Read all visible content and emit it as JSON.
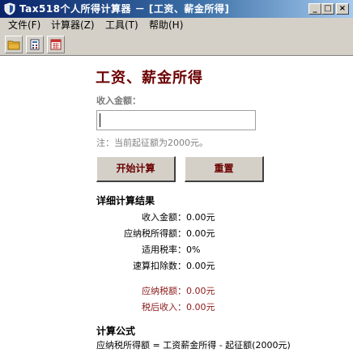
{
  "window": {
    "title": "Tax518个人所得计算器 － [工资、薪金所得]",
    "min_glyph": "_",
    "max_glyph": "□",
    "close_glyph": "×"
  },
  "menu": {
    "items": [
      {
        "label": "文件(F)"
      },
      {
        "label": "计算器(Z)"
      },
      {
        "label": "工具(T)"
      },
      {
        "label": "帮助(H)"
      }
    ]
  },
  "toolbar": {
    "icons": [
      "folder-icon",
      "calculator-doc-icon",
      "calendar-icon"
    ]
  },
  "form": {
    "heading": "工资、薪金所得",
    "income_label": "收入金额：",
    "income_value": "",
    "note": "注：当前起征额为2000元。",
    "start_button": "开始计算",
    "reset_button": "重置"
  },
  "results": {
    "title": "详细计算结果",
    "rows": [
      {
        "label": "收入金额：",
        "value": "0.00元"
      },
      {
        "label": "应纳税所得额：",
        "value": "0.00元"
      },
      {
        "label": "适用税率：",
        "value": "0%"
      },
      {
        "label": "速算扣除数：",
        "value": "0.00元"
      }
    ],
    "tax_rows": [
      {
        "label": "应纳税额：",
        "value": "0.00元"
      },
      {
        "label": "税后收入：",
        "value": "0.00元"
      }
    ]
  },
  "formula": {
    "title": "计算公式",
    "text": "应纳税所得额 = 工资薪金所得 - 起征额(2000元)"
  },
  "colors": {
    "accent": "#6b0000",
    "result_red": "#8b1a1a",
    "chrome": "#d4d0c8",
    "titlebar": "#0a246a"
  }
}
